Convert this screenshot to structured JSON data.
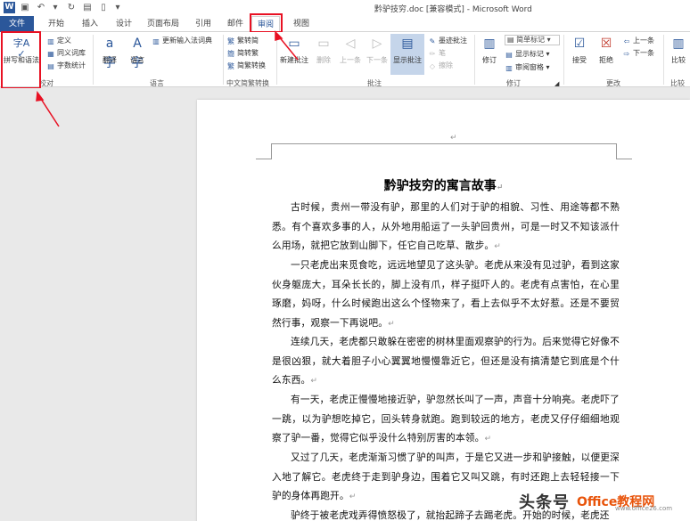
{
  "titlebar": {
    "app_logo": "W",
    "title": "黔驴技穷.doc [兼容模式] - Microsoft Word",
    "quick_access": [
      "save-icon",
      "undo-icon",
      "redo-icon",
      "print-preview-icon",
      "document-icon",
      "dropdown-icon"
    ]
  },
  "tabs": {
    "file": "文件",
    "items": [
      "开始",
      "插入",
      "设计",
      "页面布局",
      "引用",
      "邮件",
      "审阅",
      "视图"
    ],
    "active": "审阅"
  },
  "ribbon": {
    "proofing": {
      "label": "校对",
      "spell": "拼写和语法",
      "spell_glyph": "字A",
      "define": "定义",
      "thesaurus": "同义词库",
      "word_count": "字数统计"
    },
    "language": {
      "label": "语言",
      "translate": "翻译",
      "language": "语言",
      "update_ime": "更新输入法词典"
    },
    "chinese_conversion": {
      "label": "中文简繁转换",
      "to_traditional": "繁转简",
      "to_simplified": "简转繁",
      "convert": "简繁转换"
    },
    "comments": {
      "label": "批注",
      "new": "新建批注",
      "delete": "删除",
      "previous": "上一条",
      "next": "下一条",
      "show": "显示批注",
      "ink_comment": "墨迹批注",
      "pen": "笔",
      "eraser": "擦除"
    },
    "tracking": {
      "label": "修订",
      "track": "修订",
      "markup_select": "简单标记",
      "show_markup": "显示标记",
      "review_pane": "审阅窗格"
    },
    "changes": {
      "label": "更改",
      "accept": "接受",
      "reject": "拒绝",
      "previous": "上一条",
      "next": "下一条"
    },
    "compare": {
      "label": "比较",
      "compare": "比较"
    }
  },
  "document": {
    "heading": "黔驴技穷的寓言故事",
    "paragraphs": [
      "古时候，贵州一带没有驴，那里的人们对于驴的相貌、习性、用途等都不熟悉。有个喜欢多事的人，从外地用船运了一头驴回贵州，可是一时又不知该派什么用场，就把它放到山脚下，任它自己吃草、散步。",
      "一只老虎出来觅食吃，远远地望见了这头驴。老虎从来没有见过驴，看到这家伙身躯庞大，耳朵长长的，脚上没有爪，样子挺吓人的。老虎有点害怕，在心里琢磨，妈呀，什么时候跑出这么个怪物来了，看上去似乎不太好惹。还是不要贸然行事，观察一下再说吧。",
      "连续几天，老虎都只敢躲在密密的树林里面观察驴的行为。后来觉得它好像不是很凶狠，就大着胆子小心翼翼地慢慢靠近它，但还是没有搞清楚它到底是个什么东西。",
      "有一天，老虎正慢慢地接近驴，驴忽然长叫了一声，声音十分响亮。老虎吓了一跳，以为驴想吃掉它，回头转身就跑。跑到较远的地方，老虎又仔仔细细地观察了驴一番，觉得它似乎没什么特别厉害的本领。",
      "又过了几天，老虎渐渐习惯了驴的叫声，于是它又进一步和驴接触，以便更深入地了解它。老虎终于走到驴身边，围着它又叫又跳，有时还跑上去轻轻接一下驴的身体再跑开。",
      "驴终于被老虎戏弄得愤怒极了，就抬起蹄子去踢老虎。开始的时候，老虎还"
    ],
    "paragraph_mark": "↵"
  },
  "watermark": {
    "text": "头条号",
    "logo": "Office教程网",
    "sub": "www.office26.com"
  },
  "colors": {
    "accent": "#2b579a",
    "highlight": "#e81123"
  }
}
